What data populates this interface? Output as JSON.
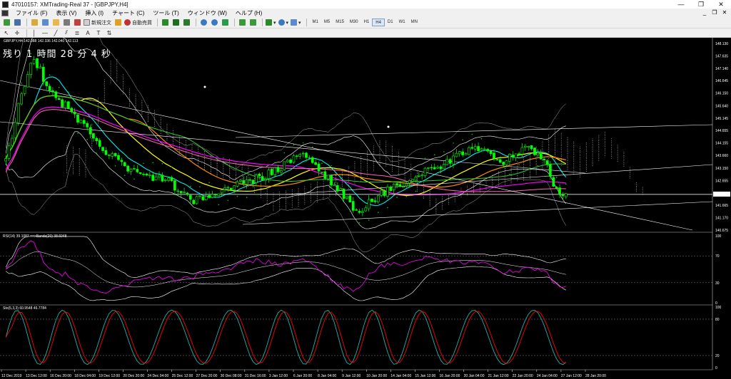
{
  "window": {
    "title": "47010157: XMTrading-Real 37 - [GBPJPY,H4]",
    "controls": [
      "—",
      "❐",
      "✕"
    ]
  },
  "menu": {
    "items": [
      "ファイル (F)",
      "表示 (V)",
      "挿入 (I)",
      "チャート (C)",
      "ツール (T)",
      "ウィンドウ (W)",
      "ヘルプ (H)"
    ],
    "right_controls": [
      "_",
      "❐",
      "✕"
    ]
  },
  "toolbar": {
    "new_order_label": "新規注文",
    "autotrade_label": "自動売買",
    "timeframes": [
      "M1",
      "M5",
      "M15",
      "M30",
      "H1",
      "H4",
      "D1",
      "W1",
      "MN"
    ],
    "active_timeframe": "H4"
  },
  "chart": {
    "symbol_line": "GBPJPY,H4  142.088 142.336 142.040 142.113",
    "countdown": "残り 1 時間 28 分 4 秒",
    "current_price": "142.113",
    "price_labels": [
      "148.130",
      "147.635",
      "147.140",
      "146.645",
      "146.150",
      "145.640",
      "145.145",
      "144.655",
      "144.155",
      "143.660",
      "143.150",
      "142.655",
      "142.113",
      "141.665",
      "141.170",
      "140.675"
    ],
    "rsi_line": "RSI(14) 39.1087  ==>Bands(20) 38.6048",
    "rsi_levels": [
      "100",
      "70",
      "30",
      "0"
    ],
    "stoch_line": "Sto(5,3,3) 60.9548 46.7784",
    "stoch_levels": [
      "100",
      "80",
      "20",
      "0"
    ],
    "time_labels": [
      "12 Dec 2019",
      "13 Dec 12:00",
      "16 Dec 20:00",
      "18 Dec 04:00",
      "19 Dec 12:00",
      "20 Dec 20:00",
      "24 Dec 04:00",
      "25 Dec 12:00",
      "27 Dec 20:00",
      "30 Dec 08:00",
      "31 Dec 16:00",
      "3 Jan 12:00",
      "6 Jan 20:00",
      "8 Jan 04:00",
      "9 Jan 12:00",
      "10 Jan 20:00",
      "14 Jan 04:00",
      "15 Jan 12:00",
      "16 Jan 20:00",
      "20 Jan 04:00",
      "21 Jan 12:00",
      "22 Jan 20:00",
      "24 Jan 04:00",
      "27 Jan 12:00",
      "28 Jan 20:00"
    ],
    "colors": {
      "background": "#000000",
      "bull_candle": "#00ff00",
      "bear_candle": "#00ff00",
      "ma_fast": "#00ffff",
      "ma_yellow": "#ffff00",
      "ma_orange": "#ff8c00",
      "ma_green": "#32cd32",
      "ma_magenta": "#ff00ff",
      "ma_pink": "#ff69b4",
      "bollinger": "#ffffff",
      "rsi": "#ff00ff",
      "stoch_main": "#20b2aa",
      "stoch_signal": "#ff0000"
    }
  }
}
